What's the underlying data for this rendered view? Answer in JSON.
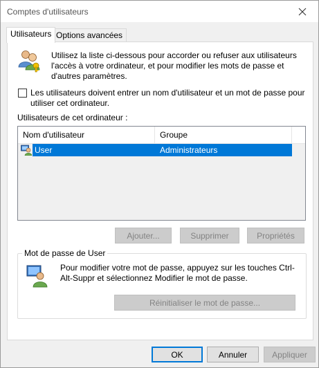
{
  "window": {
    "title": "Comptes d'utilisateurs"
  },
  "tabs": [
    {
      "label": "Utilisateurs",
      "active": true
    },
    {
      "label": "Options avancées",
      "active": false
    }
  ],
  "intro": {
    "icon": "users-icon",
    "text": "Utilisez la liste ci-dessous pour accorder ou refuser aux utilisateurs l'accès à votre ordinateur, et pour modifier les mots de passe et d'autres paramètres."
  },
  "require_login": {
    "checked": false,
    "label": "Les utilisateurs doivent entrer un nom d'utilisateur et un mot de passe pour utiliser cet ordinateur."
  },
  "users": {
    "header": "Utilisateurs de cet ordinateur :",
    "columns": [
      "Nom d'utilisateur",
      "Groupe"
    ],
    "rows": [
      {
        "name": "User",
        "group": "Administrateurs",
        "selected": true
      }
    ]
  },
  "list_buttons": {
    "add": "Ajouter...",
    "remove": "Supprimer",
    "properties": "Propriétés"
  },
  "password_group": {
    "legend": "Mot de passe de User",
    "text": "Pour modifier votre mot de passe, appuyez sur les touches Ctrl-Alt-Suppr et sélectionnez Modifier le mot de passe.",
    "reset_button": "Réinitialiser le mot de passe..."
  },
  "footer": {
    "ok": "OK",
    "cancel": "Annuler",
    "apply": "Appliquer"
  },
  "colors": {
    "selection": "#0078d7",
    "dialog_bg": "#f0f0f0",
    "panel_bg": "#ffffff",
    "disabled_text": "#838383"
  }
}
